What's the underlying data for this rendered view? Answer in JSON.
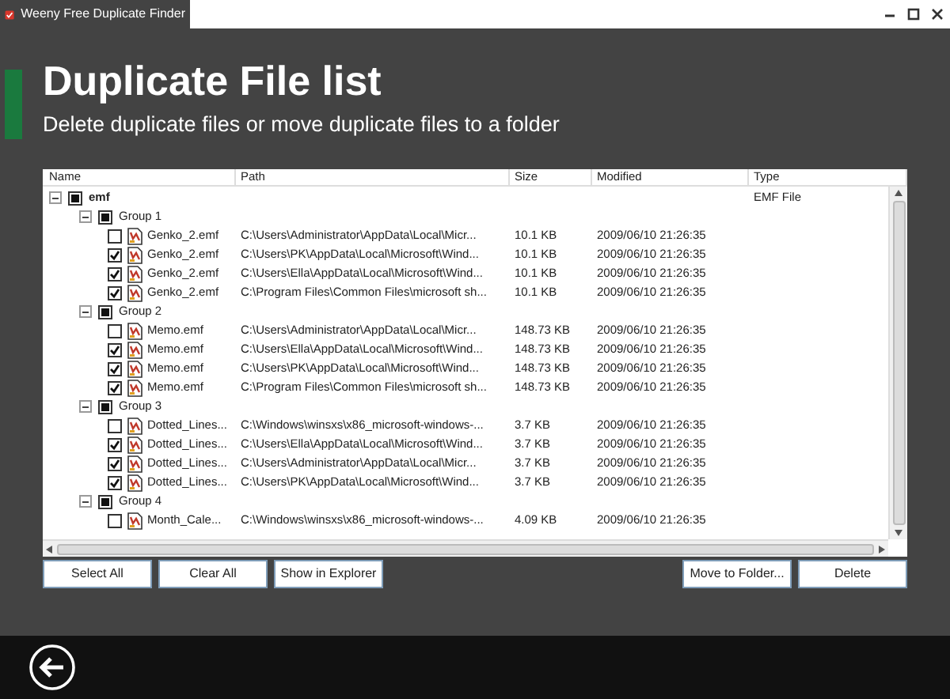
{
  "window": {
    "title": "Weeny Free Duplicate Finder"
  },
  "heading": "Duplicate File list",
  "subtitle": "Delete duplicate files or move duplicate files to a folder",
  "table": {
    "columns": [
      "Name",
      "Path",
      "Size",
      "Modified",
      "Type"
    ],
    "tree": [
      {
        "name": "emf",
        "type": "EMF File",
        "expanded": true,
        "indeterminate": true,
        "children": [
          {
            "name": "Group 1",
            "expanded": true,
            "indeterminate": true,
            "children": [
              {
                "name": "Genko_2.emf",
                "path": "C:\\Users\\Administrator\\AppData\\Local\\Micr...",
                "size": "10.1 KB",
                "modified": "2009/06/10 21:26:35",
                "checked": false
              },
              {
                "name": "Genko_2.emf",
                "path": "C:\\Users\\PK\\AppData\\Local\\Microsoft\\Wind...",
                "size": "10.1 KB",
                "modified": "2009/06/10 21:26:35",
                "checked": true
              },
              {
                "name": "Genko_2.emf",
                "path": "C:\\Users\\Ella\\AppData\\Local\\Microsoft\\Wind...",
                "size": "10.1 KB",
                "modified": "2009/06/10 21:26:35",
                "checked": true
              },
              {
                "name": "Genko_2.emf",
                "path": "C:\\Program Files\\Common Files\\microsoft sh...",
                "size": "10.1 KB",
                "modified": "2009/06/10 21:26:35",
                "checked": true
              }
            ]
          },
          {
            "name": "Group 2",
            "expanded": true,
            "indeterminate": true,
            "children": [
              {
                "name": "Memo.emf",
                "path": "C:\\Users\\Administrator\\AppData\\Local\\Micr...",
                "size": "148.73 KB",
                "modified": "2009/06/10 21:26:35",
                "checked": false
              },
              {
                "name": "Memo.emf",
                "path": "C:\\Users\\Ella\\AppData\\Local\\Microsoft\\Wind...",
                "size": "148.73 KB",
                "modified": "2009/06/10 21:26:35",
                "checked": true
              },
              {
                "name": "Memo.emf",
                "path": "C:\\Users\\PK\\AppData\\Local\\Microsoft\\Wind...",
                "size": "148.73 KB",
                "modified": "2009/06/10 21:26:35",
                "checked": true
              },
              {
                "name": "Memo.emf",
                "path": "C:\\Program Files\\Common Files\\microsoft sh...",
                "size": "148.73 KB",
                "modified": "2009/06/10 21:26:35",
                "checked": true
              }
            ]
          },
          {
            "name": "Group 3",
            "expanded": true,
            "indeterminate": true,
            "children": [
              {
                "name": "Dotted_Lines...",
                "path": "C:\\Windows\\winsxs\\x86_microsoft-windows-...",
                "size": "3.7 KB",
                "modified": "2009/06/10 21:26:35",
                "checked": false
              },
              {
                "name": "Dotted_Lines...",
                "path": "C:\\Users\\Ella\\AppData\\Local\\Microsoft\\Wind...",
                "size": "3.7 KB",
                "modified": "2009/06/10 21:26:35",
                "checked": true
              },
              {
                "name": "Dotted_Lines...",
                "path": "C:\\Users\\Administrator\\AppData\\Local\\Micr...",
                "size": "3.7 KB",
                "modified": "2009/06/10 21:26:35",
                "checked": true
              },
              {
                "name": "Dotted_Lines...",
                "path": "C:\\Users\\PK\\AppData\\Local\\Microsoft\\Wind...",
                "size": "3.7 KB",
                "modified": "2009/06/10 21:26:35",
                "checked": true
              }
            ]
          },
          {
            "name": "Group 4",
            "expanded": true,
            "indeterminate": true,
            "children": [
              {
                "name": "Month_Cale...",
                "path": "C:\\Windows\\winsxs\\x86_microsoft-windows-...",
                "size": "4.09 KB",
                "modified": "2009/06/10 21:26:35",
                "checked": false
              }
            ]
          }
        ]
      }
    ]
  },
  "buttons_left": [
    "Select All",
    "Clear All",
    "Show in Explorer"
  ],
  "buttons_right": [
    "Move to Folder...",
    "Delete"
  ]
}
